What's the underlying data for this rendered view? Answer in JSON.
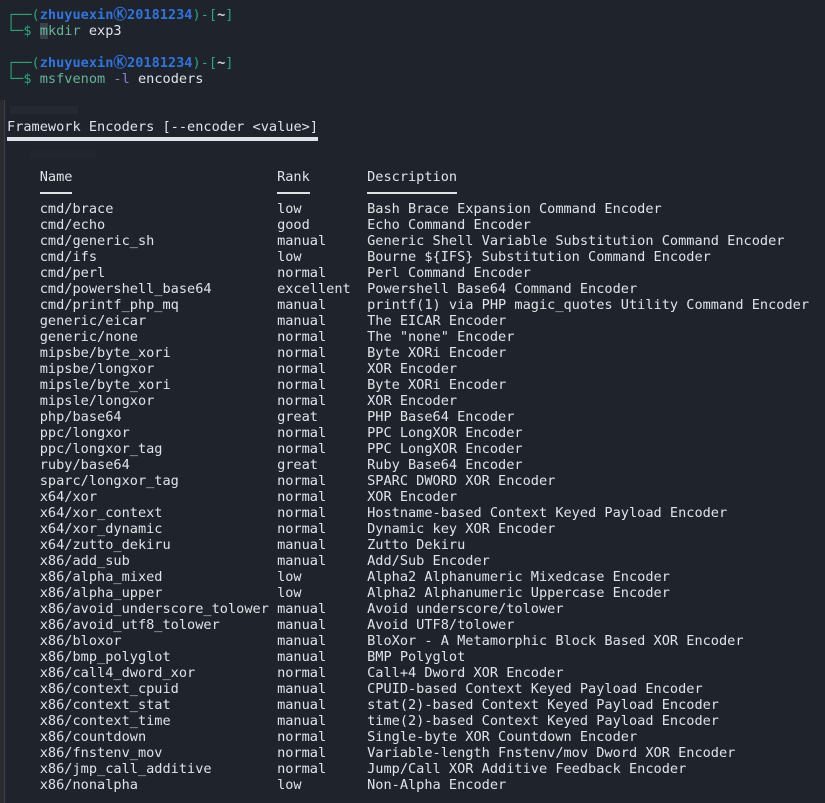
{
  "colors": {
    "background": "#1e232c",
    "foreground": "#e0e4e8",
    "prompt_frame_green": "#2ca578",
    "user_host_blue": "#3174dd",
    "command_green": "#66b398",
    "option_purple": "#8782d1",
    "cursor_block": "#3a414b"
  },
  "terminal": {
    "prompts": [
      {
        "frame_open": "┌──(",
        "user": "zhuyuexin",
        "separator_glyph": "Ⓚ",
        "host": "20181234",
        "frame_mid": ")-[",
        "path": "~",
        "frame_close": "]",
        "prompt_symbol": "└─$",
        "command": "mkdir",
        "command_head": "m",
        "command_tail": "kdir",
        "argument": "exp3"
      },
      {
        "frame_open": "┌──(",
        "user": "zhuyuexin",
        "separator_glyph": "Ⓚ",
        "host": "20181234",
        "frame_mid": ")-[",
        "path": "~",
        "frame_close": "]",
        "prompt_symbol": "└─$",
        "command": "msfvenom",
        "option": "-l",
        "argument": "encoders"
      }
    ],
    "output": {
      "title": "Framework Encoders [--encoder <value>]",
      "columns": [
        "Name",
        "Rank",
        "Description"
      ],
      "encoders": [
        {
          "name": "cmd/brace",
          "rank": "low",
          "description": "Bash Brace Expansion Command Encoder"
        },
        {
          "name": "cmd/echo",
          "rank": "good",
          "description": "Echo Command Encoder"
        },
        {
          "name": "cmd/generic_sh",
          "rank": "manual",
          "description": "Generic Shell Variable Substitution Command Encoder"
        },
        {
          "name": "cmd/ifs",
          "rank": "low",
          "description": "Bourne ${IFS} Substitution Command Encoder"
        },
        {
          "name": "cmd/perl",
          "rank": "normal",
          "description": "Perl Command Encoder"
        },
        {
          "name": "cmd/powershell_base64",
          "rank": "excellent",
          "description": "Powershell Base64 Command Encoder"
        },
        {
          "name": "cmd/printf_php_mq",
          "rank": "manual",
          "description": "printf(1) via PHP magic_quotes Utility Command Encoder"
        },
        {
          "name": "generic/eicar",
          "rank": "manual",
          "description": "The EICAR Encoder"
        },
        {
          "name": "generic/none",
          "rank": "normal",
          "description": "The \"none\" Encoder"
        },
        {
          "name": "mipsbe/byte_xori",
          "rank": "normal",
          "description": "Byte XORi Encoder"
        },
        {
          "name": "mipsbe/longxor",
          "rank": "normal",
          "description": "XOR Encoder"
        },
        {
          "name": "mipsle/byte_xori",
          "rank": "normal",
          "description": "Byte XORi Encoder"
        },
        {
          "name": "mipsle/longxor",
          "rank": "normal",
          "description": "XOR Encoder"
        },
        {
          "name": "php/base64",
          "rank": "great",
          "description": "PHP Base64 Encoder"
        },
        {
          "name": "ppc/longxor",
          "rank": "normal",
          "description": "PPC LongXOR Encoder"
        },
        {
          "name": "ppc/longxor_tag",
          "rank": "normal",
          "description": "PPC LongXOR Encoder"
        },
        {
          "name": "ruby/base64",
          "rank": "great",
          "description": "Ruby Base64 Encoder"
        },
        {
          "name": "sparc/longxor_tag",
          "rank": "normal",
          "description": "SPARC DWORD XOR Encoder"
        },
        {
          "name": "x64/xor",
          "rank": "normal",
          "description": "XOR Encoder"
        },
        {
          "name": "x64/xor_context",
          "rank": "normal",
          "description": "Hostname-based Context Keyed Payload Encoder"
        },
        {
          "name": "x64/xor_dynamic",
          "rank": "normal",
          "description": "Dynamic key XOR Encoder"
        },
        {
          "name": "x64/zutto_dekiru",
          "rank": "manual",
          "description": "Zutto Dekiru"
        },
        {
          "name": "x86/add_sub",
          "rank": "manual",
          "description": "Add/Sub Encoder"
        },
        {
          "name": "x86/alpha_mixed",
          "rank": "low",
          "description": "Alpha2 Alphanumeric Mixedcase Encoder"
        },
        {
          "name": "x86/alpha_upper",
          "rank": "low",
          "description": "Alpha2 Alphanumeric Uppercase Encoder"
        },
        {
          "name": "x86/avoid_underscore_tolower",
          "rank": "manual",
          "description": "Avoid underscore/tolower"
        },
        {
          "name": "x86/avoid_utf8_tolower",
          "rank": "manual",
          "description": "Avoid UTF8/tolower"
        },
        {
          "name": "x86/bloxor",
          "rank": "manual",
          "description": "BloXor - A Metamorphic Block Based XOR Encoder"
        },
        {
          "name": "x86/bmp_polyglot",
          "rank": "manual",
          "description": "BMP Polyglot"
        },
        {
          "name": "x86/call4_dword_xor",
          "rank": "normal",
          "description": "Call+4 Dword XOR Encoder"
        },
        {
          "name": "x86/context_cpuid",
          "rank": "manual",
          "description": "CPUID-based Context Keyed Payload Encoder"
        },
        {
          "name": "x86/context_stat",
          "rank": "manual",
          "description": "stat(2)-based Context Keyed Payload Encoder"
        },
        {
          "name": "x86/context_time",
          "rank": "manual",
          "description": "time(2)-based Context Keyed Payload Encoder"
        },
        {
          "name": "x86/countdown",
          "rank": "normal",
          "description": "Single-byte XOR Countdown Encoder"
        },
        {
          "name": "x86/fnstenv_mov",
          "rank": "normal",
          "description": "Variable-length Fnstenv/mov Dword XOR Encoder"
        },
        {
          "name": "x86/jmp_call_additive",
          "rank": "normal",
          "description": "Jump/Call XOR Additive Feedback Encoder"
        },
        {
          "name": "x86/nonalpha",
          "rank": "low",
          "description": "Non-Alpha Encoder"
        }
      ]
    }
  }
}
